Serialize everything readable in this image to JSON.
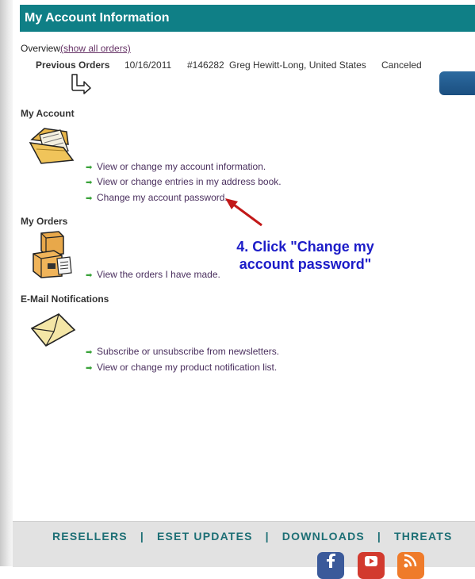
{
  "header": {
    "title": "My Account Information"
  },
  "overview": {
    "label": "Overview",
    "show_all_link": "(show all orders)",
    "previous_orders_label": "Previous Orders",
    "order": {
      "date": "10/16/2011",
      "number": "#146282",
      "customer": "Greg Hewitt-Long, United States",
      "status": "Canceled"
    }
  },
  "my_account": {
    "title": "My Account",
    "links": [
      "View or change my account information.",
      "View or change entries in my address book.",
      "Change my account password."
    ]
  },
  "my_orders": {
    "title": "My Orders",
    "links": [
      "View the orders I have made."
    ]
  },
  "email_notifications": {
    "title": "E-Mail Notifications",
    "links": [
      "Subscribe or unsubscribe from newsletters.",
      "View or change my product notification list."
    ]
  },
  "callout": {
    "line1": "4. Click \"Change my",
    "line2": "account password\""
  },
  "footer": {
    "nav": [
      "RESELLERS",
      "ESET UPDATES",
      "DOWNLOADS",
      "THREATS"
    ],
    "separator": "|"
  },
  "colors": {
    "header_bg": "#0f7f86",
    "link": "#4a2f5e",
    "bullet_arrow": "#3aa33a",
    "callout_text": "#1c1cc8",
    "annotation_arrow": "#c21818"
  },
  "icons": [
    "return-arrow-icon",
    "folder-icon",
    "boxes-icon",
    "envelope-icon",
    "facebook-icon",
    "youtube-icon",
    "rss-icon"
  ]
}
